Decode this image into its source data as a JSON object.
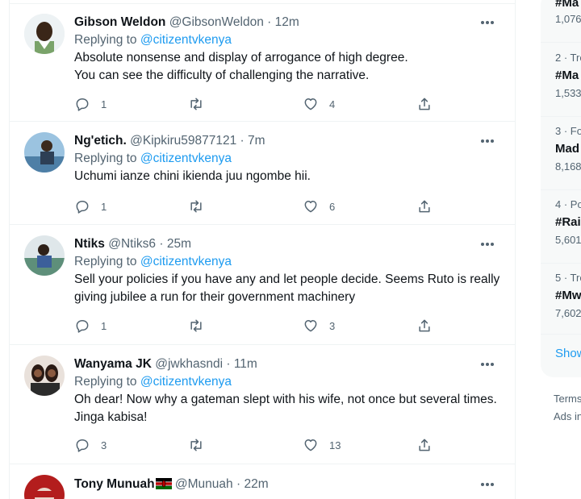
{
  "tweets": [
    {
      "name": "Gibson Weldon",
      "handle": "@GibsonWeldon",
      "separator": "·",
      "time": "12m",
      "replying_prefix": "Replying to",
      "replying_to": "@citizentvkenya",
      "text_lines": [
        "Absolute nonsense and display of arrogance of high degree.",
        "You can see the difficulty of challenging the narrative."
      ],
      "replies": "1",
      "retweets": "",
      "likes": "4"
    },
    {
      "name": "Ng'etich.",
      "handle": "@Kipkiru59877121",
      "separator": "·",
      "time": "7m",
      "replying_prefix": "Replying to",
      "replying_to": "@citizentvkenya",
      "text_lines": [
        "Uchumi ianze chini ikienda juu ngombe hii."
      ],
      "replies": "1",
      "retweets": "",
      "likes": "6"
    },
    {
      "name": "Ntiks",
      "handle": "@Ntiks6",
      "separator": "·",
      "time": "25m",
      "replying_prefix": "Replying to",
      "replying_to": "@citizentvkenya",
      "text_lines": [
        "Sell your policies if you have any and let people decide. Seems Ruto is really",
        "giving jubilee a run for their government machinery"
      ],
      "replies": "1",
      "retweets": "",
      "likes": "3"
    },
    {
      "name": "Wanyama JK",
      "handle": "@jwkhasndi",
      "separator": "·",
      "time": "11m",
      "replying_prefix": "Replying to",
      "replying_to": "@citizentvkenya",
      "text_lines": [
        "Oh dear! Now why a gateman slept with his wife, not once but several times.",
        "Jinga kabisa!"
      ],
      "replies": "3",
      "retweets": "",
      "likes": "13"
    },
    {
      "name": "Tony Munuah",
      "handle": "@Munuah",
      "separator": "·",
      "time": "22m"
    }
  ],
  "trends": [
    {
      "tag": "#Ma",
      "count": "1,076"
    },
    {
      "meta": "2 · Tre",
      "tag": "#Ma",
      "count": "1,533"
    },
    {
      "meta": "3 · Fo",
      "tag": "Mad",
      "count": "8,168"
    },
    {
      "meta": "4 · Po",
      "tag": "#Rai",
      "count": "5,601"
    },
    {
      "meta": "5 · Tre",
      "tag": "#Mw",
      "count": "7,602"
    }
  ],
  "show_more": "Show",
  "footer": {
    "line1": "Terms",
    "line2": "Ads in"
  },
  "colors": {
    "accent": "#1d9bf0",
    "muted": "#536471",
    "text": "#0f1419",
    "border": "#eff3f4"
  },
  "icons": {
    "reply": "reply-icon",
    "retweet": "retweet-icon",
    "like": "heart-icon",
    "share": "share-icon",
    "more": "more-icon"
  }
}
